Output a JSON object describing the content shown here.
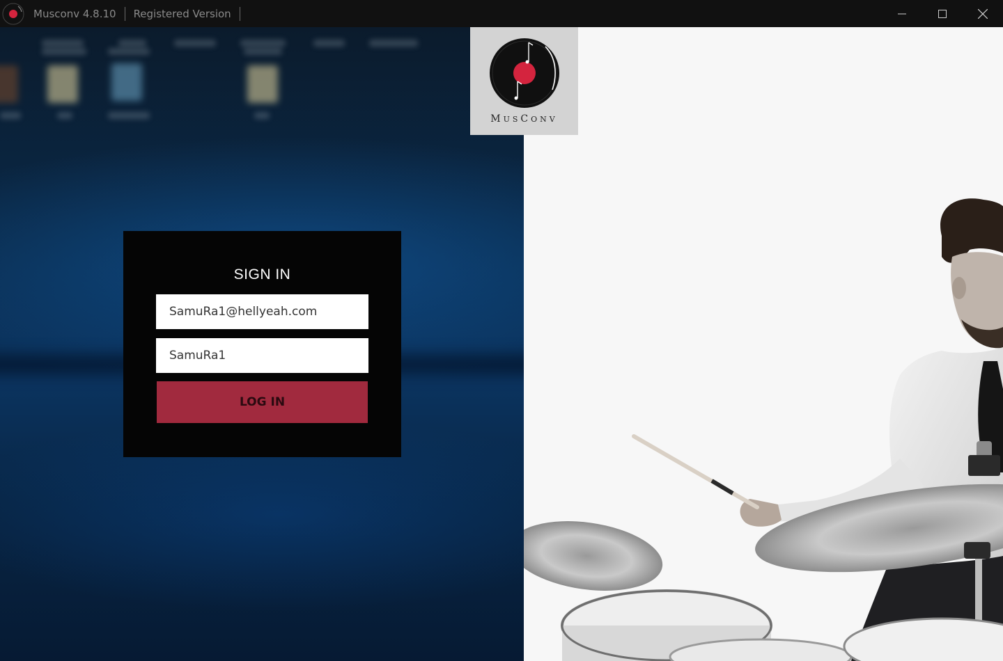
{
  "titlebar": {
    "app_name": "Musconv 4.8.10",
    "license": "Registered Version",
    "icon": "vinyl-record-icon",
    "controls": [
      "minimize-icon",
      "maximize-icon",
      "close-icon"
    ]
  },
  "logo": {
    "word_parts": [
      "M",
      "US",
      "C",
      "ONV"
    ],
    "icon": "vinyl-record-logo-icon"
  },
  "signin": {
    "title": "SIGN IN",
    "email_value": "SamuRa1@hellyeah.com",
    "password_value": "SamuRa1",
    "login_label": "LOG IN"
  },
  "colors": {
    "accent": "#a12a3e",
    "logo_red": "#d4243e",
    "titlebar_bg": "#111111",
    "signin_bg": "#050505"
  }
}
